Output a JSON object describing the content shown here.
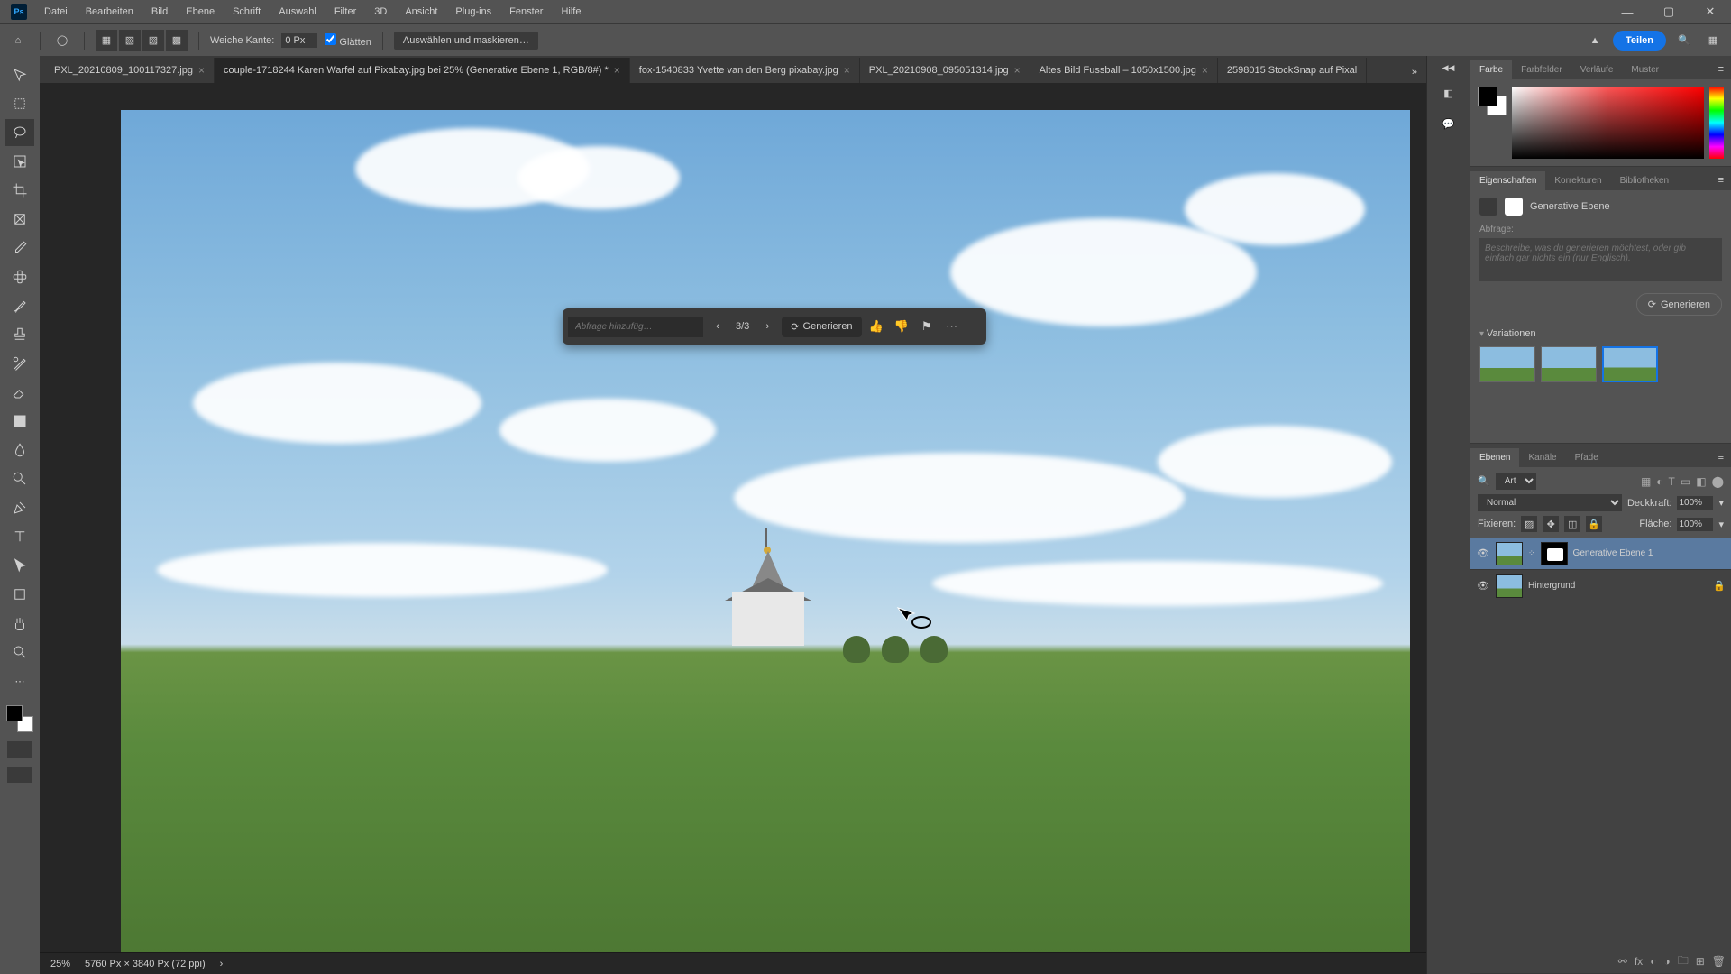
{
  "menu": {
    "items": [
      "Datei",
      "Bearbeiten",
      "Bild",
      "Ebene",
      "Schrift",
      "Auswahl",
      "Filter",
      "3D",
      "Ansicht",
      "Plug-ins",
      "Fenster",
      "Hilfe"
    ]
  },
  "optbar": {
    "feather_label": "Weiche Kante:",
    "feather_value": "0 Px",
    "antialias": "Glätten",
    "selectmask": "Auswählen und maskieren…",
    "share": "Teilen"
  },
  "tabs": [
    {
      "label": "PXL_20210809_100117327.jpg",
      "close": "×"
    },
    {
      "label": "couple-1718244 Karen Warfel auf Pixabay.jpg bei 25% (Generative Ebene 1, RGB/8#) *",
      "close": "×",
      "active": true
    },
    {
      "label": "fox-1540833 Yvette van den Berg pixabay.jpg",
      "close": "×"
    },
    {
      "label": "PXL_20210908_095051314.jpg",
      "close": "×"
    },
    {
      "label": "Altes Bild Fussball – 1050x1500.jpg",
      "close": "×"
    },
    {
      "label": "2598015 StockSnap auf Pixal",
      "close": ""
    }
  ],
  "genbar": {
    "placeholder": "Abfrage hinzufüg…",
    "count": "3/3",
    "generate": "Generieren"
  },
  "status": {
    "zoom": "25%",
    "docinfo": "5760 Px × 3840 Px (72 ppi)"
  },
  "panels": {
    "color": {
      "tabs": [
        "Farbe",
        "Farbfelder",
        "Verläufe",
        "Muster"
      ]
    },
    "props": {
      "tabs": [
        "Eigenschaften",
        "Korrekturen",
        "Bibliotheken"
      ],
      "title": "Generative Ebene",
      "prompt_label": "Abfrage:",
      "prompt_placeholder": "Beschreibe, was du generieren möchtest, oder gib einfach gar nichts ein (nur Englisch).",
      "generate": "Generieren",
      "variations": "Variationen"
    },
    "layers": {
      "tabs": [
        "Ebenen",
        "Kanäle",
        "Pfade"
      ],
      "kind": "Art",
      "blend": "Normal",
      "opacity_label": "Deckkraft:",
      "opacity": "100%",
      "lock_label": "Fixieren:",
      "fill_label": "Fläche:",
      "fill": "100%",
      "items": [
        {
          "name": "Generative Ebene 1",
          "selected": true,
          "hasMask": true
        },
        {
          "name": "Hintergrund",
          "locked": true
        }
      ]
    }
  }
}
